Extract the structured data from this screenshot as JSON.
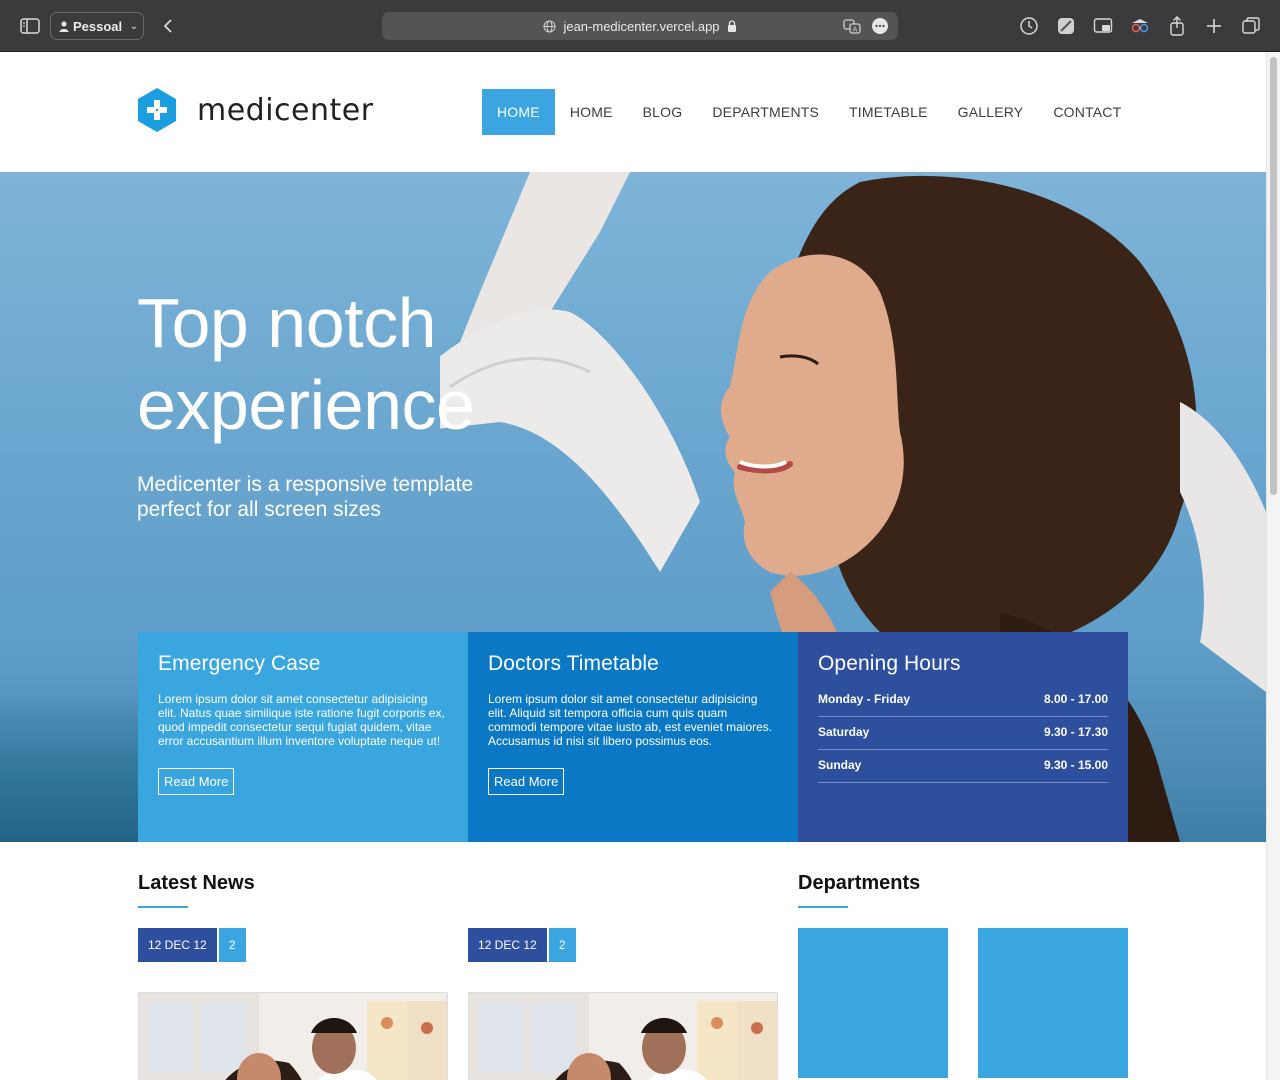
{
  "browser": {
    "profile_label": "Pessoal",
    "url": "jean-medicenter.vercel.app"
  },
  "site": {
    "logo_text": "medicenter",
    "nav": [
      "HOME",
      "HOME",
      "BLOG",
      "DEPARTMENTS",
      "TIMETABLE",
      "GALLERY",
      "CONTACT"
    ],
    "active_nav": "HOME"
  },
  "hero": {
    "headline_line1": "Top notch",
    "headline_line2": "experience",
    "subtitle": "Medicenter is a responsive template perfect for all screen sizes"
  },
  "boxes": {
    "emergency": {
      "title": "Emergency Case",
      "text": "Lorem ipsum dolor sit amet consectetur adipisicing elit. Natus quae similique iste ratione fugit corporis ex, quod impedit consectetur sequi fugiat quidem, vitae error accusantium illum inventore voluptate neque ut!",
      "button": "Read More"
    },
    "timetable": {
      "title": "Doctors Timetable",
      "text": "Lorem ipsum dolor sit amet consectetur adipisicing elit. Aliquid sit tempora officia cum quis quam commodi tempore vitae iusto ab, est eveniet maiores. Accusamus id nisi sit libero possimus eos.",
      "button": "Read More"
    },
    "hours": {
      "title": "Opening Hours",
      "rows": [
        {
          "day": "Monday - Friday",
          "time": "8.00 - 17.00"
        },
        {
          "day": "Saturday",
          "time": "9.30 - 17.30"
        },
        {
          "day": "Sunday",
          "time": "9.30 - 15.00"
        }
      ]
    }
  },
  "news": {
    "title": "Latest News",
    "posts": [
      {
        "date": "12 DEC 12",
        "comments": "2"
      },
      {
        "date": "12 DEC 12",
        "comments": "2"
      }
    ]
  },
  "departments": {
    "title": "Departments"
  },
  "colors": {
    "accent": "#3aa5e0",
    "medium_blue": "#0a78c5",
    "dark_blue": "#2d4f9e"
  }
}
